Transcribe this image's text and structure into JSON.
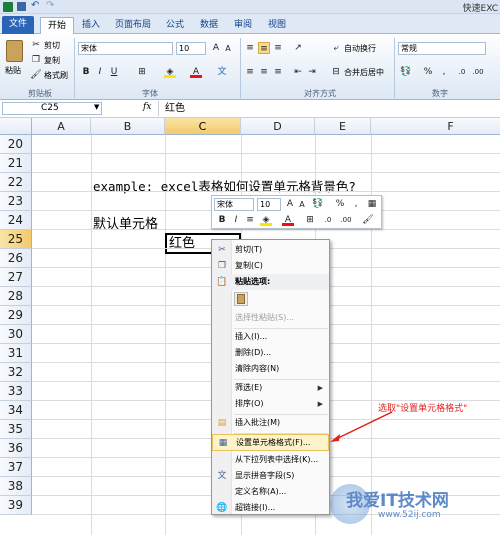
{
  "window": {
    "title_partial": "快速EXC"
  },
  "ribbon_tabs": [
    {
      "label": "文件"
    },
    {
      "label": "开始"
    },
    {
      "label": "插入"
    },
    {
      "label": "页面布局"
    },
    {
      "label": "公式"
    },
    {
      "label": "数据"
    },
    {
      "label": "审阅"
    },
    {
      "label": "视图"
    }
  ],
  "clipboard": {
    "paste": "粘贴",
    "cut": "剪切",
    "copy": "复制",
    "format_painter": "格式刷",
    "group": "剪贴板"
  },
  "font": {
    "name": "宋体",
    "size": "10",
    "bold": "B",
    "italic": "I",
    "underline": "U",
    "group": "字体"
  },
  "alignment": {
    "wrap": "自动换行",
    "merge": "合并后居中",
    "group": "对齐方式"
  },
  "number": {
    "format": "常规",
    "percent": "%",
    "comma": ",",
    "group": "数字"
  },
  "formula_bar": {
    "name_box": "C25",
    "fx": "fx",
    "content": "红色"
  },
  "columns": [
    "A",
    "B",
    "C",
    "D",
    "E",
    "F"
  ],
  "rows": [
    "20",
    "21",
    "22",
    "23",
    "24",
    "25",
    "26",
    "27",
    "28",
    "29",
    "30",
    "31",
    "32",
    "33",
    "34",
    "35",
    "36",
    "37",
    "38",
    "39"
  ],
  "cells": {
    "B22": "example:  excel表格如何设置单元格背景色?",
    "B24": "默认单元格",
    "C25": "红色"
  },
  "mini_toolbar": {
    "font": "宋体",
    "size": "10",
    "bold": "B",
    "italic": "I",
    "align": "≡",
    "percent": "%",
    "comma": ","
  },
  "context_menu": [
    {
      "label": "剪切(T)",
      "icon": "scissors-icon",
      "disabled": false
    },
    {
      "label": "复制(C)",
      "icon": "copy-icon",
      "disabled": false
    },
    {
      "label": "粘贴选项:",
      "icon": "paste-icon",
      "disabled": false,
      "bold": true
    },
    {
      "label": "选择性粘贴(S)...",
      "disabled": true
    },
    {
      "label": "插入(I)...",
      "disabled": false
    },
    {
      "label": "删除(D)...",
      "disabled": false
    },
    {
      "label": "清除内容(N)",
      "disabled": false
    },
    {
      "label": "筛选(E)",
      "disabled": false,
      "submenu": true
    },
    {
      "label": "排序(O)",
      "disabled": false,
      "submenu": true
    },
    {
      "label": "插入批注(M)",
      "icon": "comment-icon",
      "disabled": false
    },
    {
      "label": "设置单元格格式(F)...",
      "icon": "format-cells-icon",
      "disabled": false,
      "highlighted": true
    },
    {
      "label": "从下拉列表中选择(K)...",
      "disabled": false
    },
    {
      "label": "显示拼音字段(S)",
      "icon": "phonetic-icon",
      "disabled": false
    },
    {
      "label": "定义名称(A)...",
      "disabled": false
    },
    {
      "label": "超链接(I)...",
      "icon": "hyperlink-icon",
      "disabled": false
    }
  ],
  "annotation": {
    "text": "选取\"设置单元格格式\""
  },
  "watermark": {
    "text": "我爱IT技术网",
    "url": "www.52ij.com"
  },
  "colors": {
    "accent": "#2a64b6",
    "annotation": "#e0231e",
    "highlight": "#fff3c9"
  }
}
